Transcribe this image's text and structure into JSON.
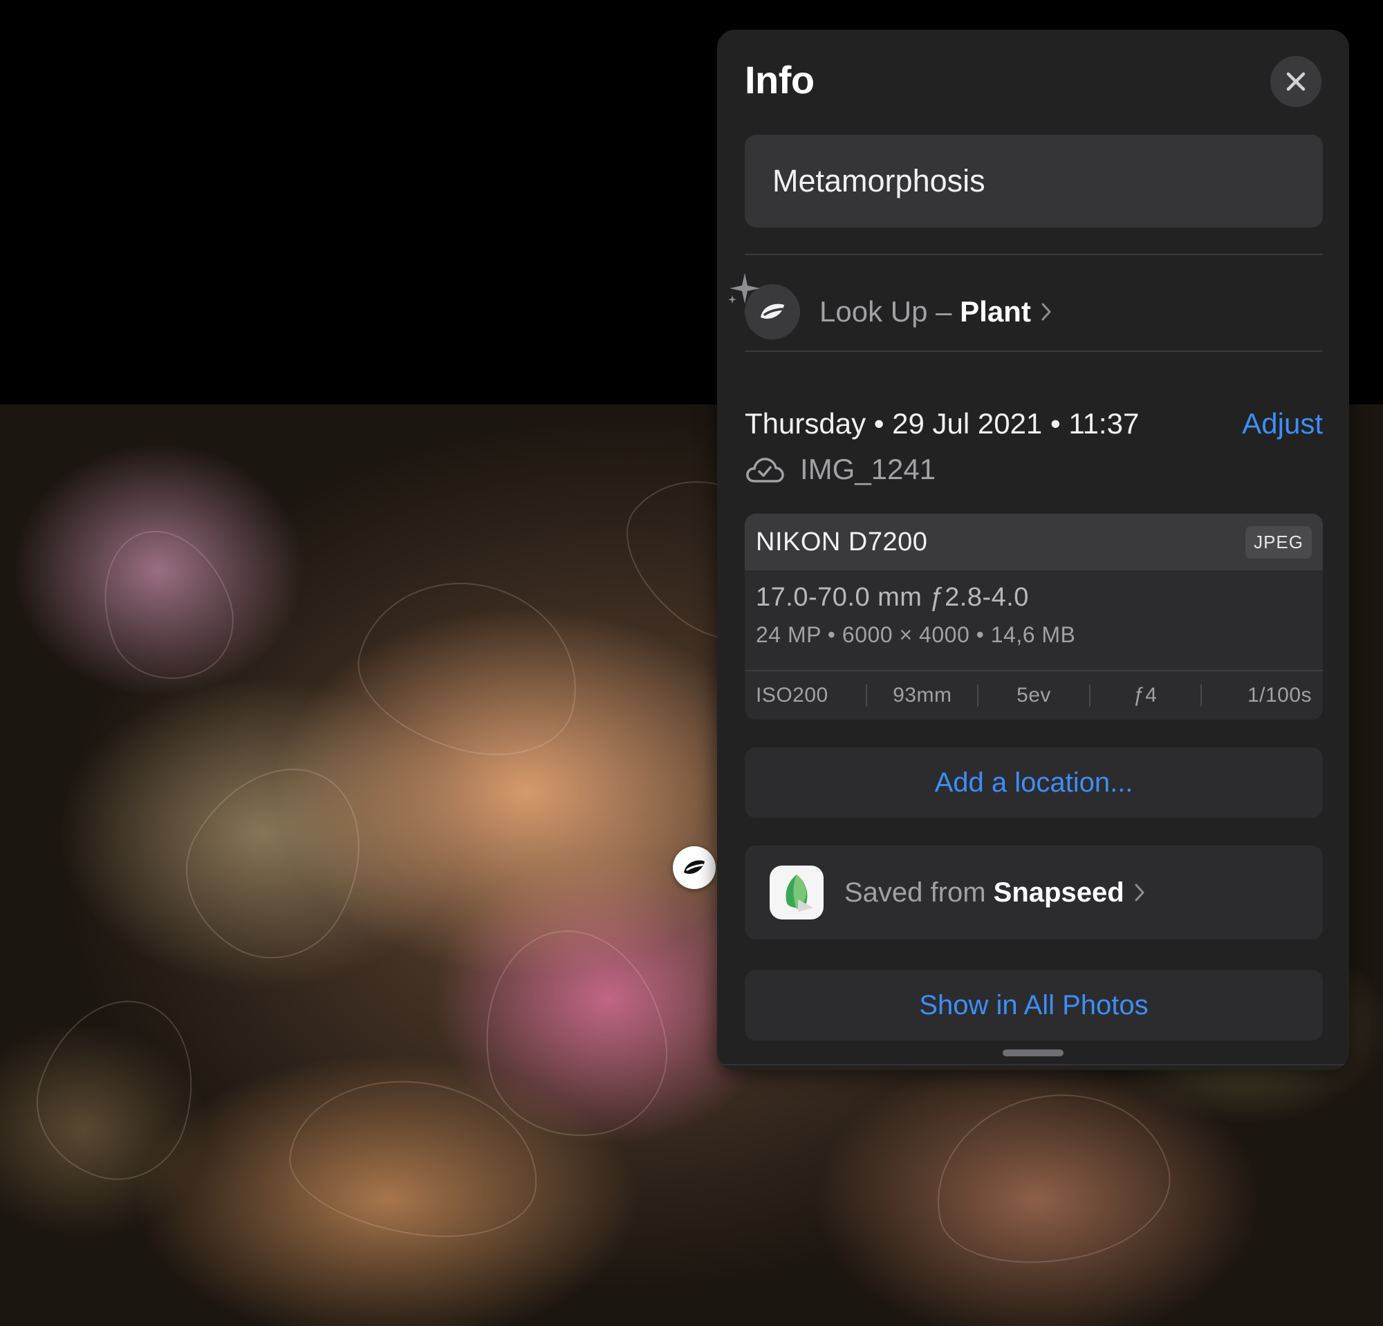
{
  "panel": {
    "title": "Info",
    "caption": "Metamorphosis",
    "lookup": {
      "prefix": "Look Up –",
      "subject": "Plant"
    },
    "date": "Thursday • 29 Jul 2021 • 11:37",
    "adjust_label": "Adjust",
    "file_name": "IMG_1241",
    "exif": {
      "camera": "NIKON D7200",
      "format": "JPEG",
      "lens": "17.0-70.0 mm ƒ2.8-4.0",
      "specs": "24 MP  •  6000 × 4000  •  14,6 MB",
      "iso": "ISO200",
      "focal_length": "93mm",
      "exposure_bias": "5ev",
      "aperture": "ƒ4",
      "shutter": "1/100s"
    },
    "add_location_label": "Add a location...",
    "source": {
      "prefix": "Saved from",
      "app": "Snapseed"
    },
    "show_all_label": "Show in All Photos"
  },
  "icons": {
    "close": "close-icon",
    "lookup": "leaf-icon",
    "sparkle": "sparkle-icon",
    "chevron": "chevron-right-icon",
    "cloud": "icloud-check-icon",
    "app": "snapseed-icon",
    "photo_lookup": "leaf-icon"
  },
  "colors": {
    "panel_bg": "#222222",
    "field_bg": "#2c2c2e",
    "accent": "#3d8ef7",
    "secondary_text": "#a1a1a6"
  }
}
